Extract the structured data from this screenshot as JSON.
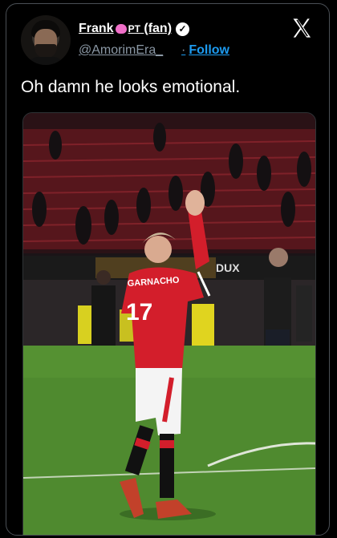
{
  "author": {
    "name_prefix": "Frank",
    "name_suffix_pt": "PT",
    "name_suffix_fan": "(fan)",
    "verified_glyph": "✓",
    "handle": "@AmorimEra_",
    "follow_label": "Follow",
    "follow_separator": "·"
  },
  "tweet": {
    "text": "Oh damn he looks emotional."
  },
  "media": {
    "jersey_name": "GARNACHO",
    "jersey_number": "17",
    "board_text": "DUX"
  },
  "colors": {
    "accent": "#1d9bf0",
    "secondary_text": "#8b98a5",
    "kit_red": "#d31e2b",
    "pitch_green": "#4f8a2f"
  },
  "icons": {
    "brand": "x-logo-icon",
    "verified": "verified-badge-icon",
    "emoji": "pink-brain-emoji-icon"
  }
}
